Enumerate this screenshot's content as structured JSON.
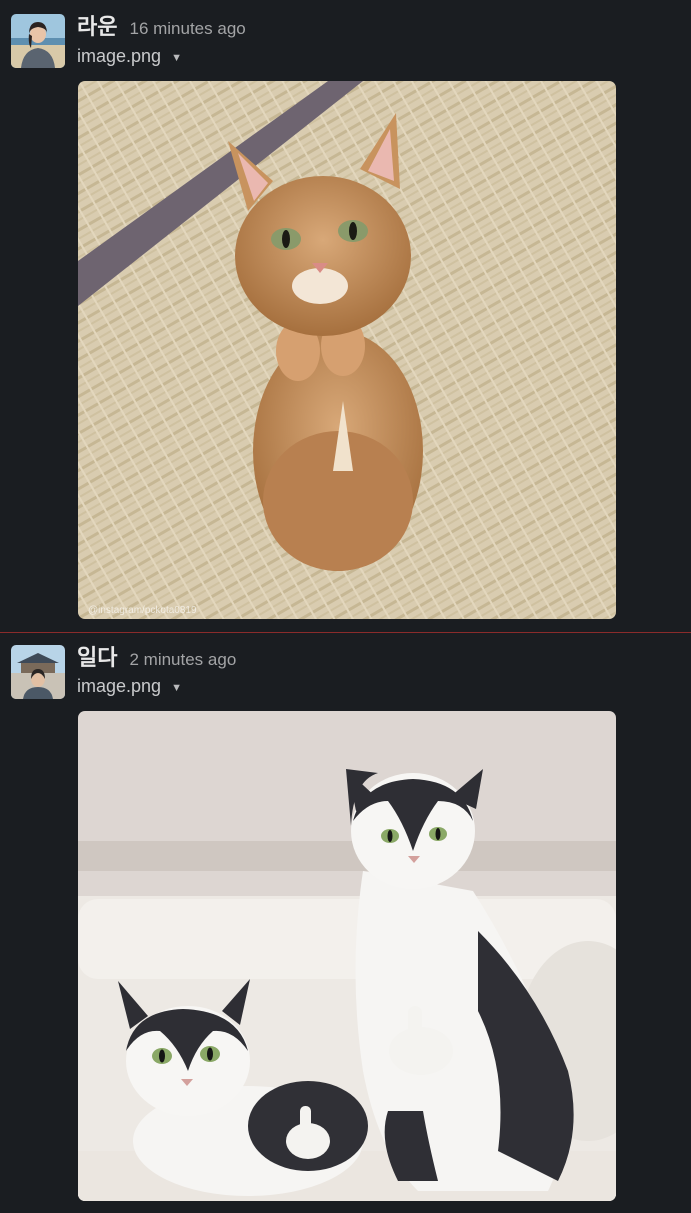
{
  "messages": [
    {
      "author": "라운",
      "timestamp": "16 minutes ago",
      "file_name": "image.png",
      "image_watermark": "@instagram/pckota0819"
    },
    {
      "author": "일다",
      "timestamp": "2 minutes ago",
      "file_name": "image.png"
    }
  ],
  "colors": {
    "background": "#1a1d21",
    "divider": "#8b2b2b",
    "timestamp": "#a3a4a6"
  }
}
